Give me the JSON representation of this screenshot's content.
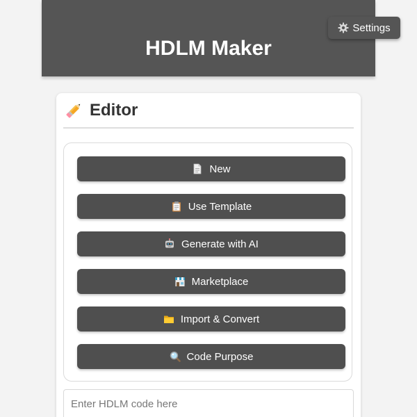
{
  "header": {
    "title": "HDLM Maker"
  },
  "settings": {
    "label": "Settings",
    "icon": "gear-icon"
  },
  "editor": {
    "title": "Editor",
    "icon": "pencil-icon",
    "actions": [
      {
        "label": "New",
        "icon": "document-icon"
      },
      {
        "label": "Use Template",
        "icon": "clipboard-icon"
      },
      {
        "label": "Generate with AI",
        "icon": "robot-icon"
      },
      {
        "label": "Marketplace",
        "icon": "store-icon"
      },
      {
        "label": "Import & Convert",
        "icon": "folder-icon"
      },
      {
        "label": "Code Purpose",
        "icon": "magnifier-icon"
      }
    ],
    "code_input": {
      "placeholder": "Enter HDLM code here",
      "value": ""
    }
  },
  "colors": {
    "header_bg": "#555555",
    "button_bg": "#4f4f4f",
    "page_bg": "#f3f3f3"
  }
}
